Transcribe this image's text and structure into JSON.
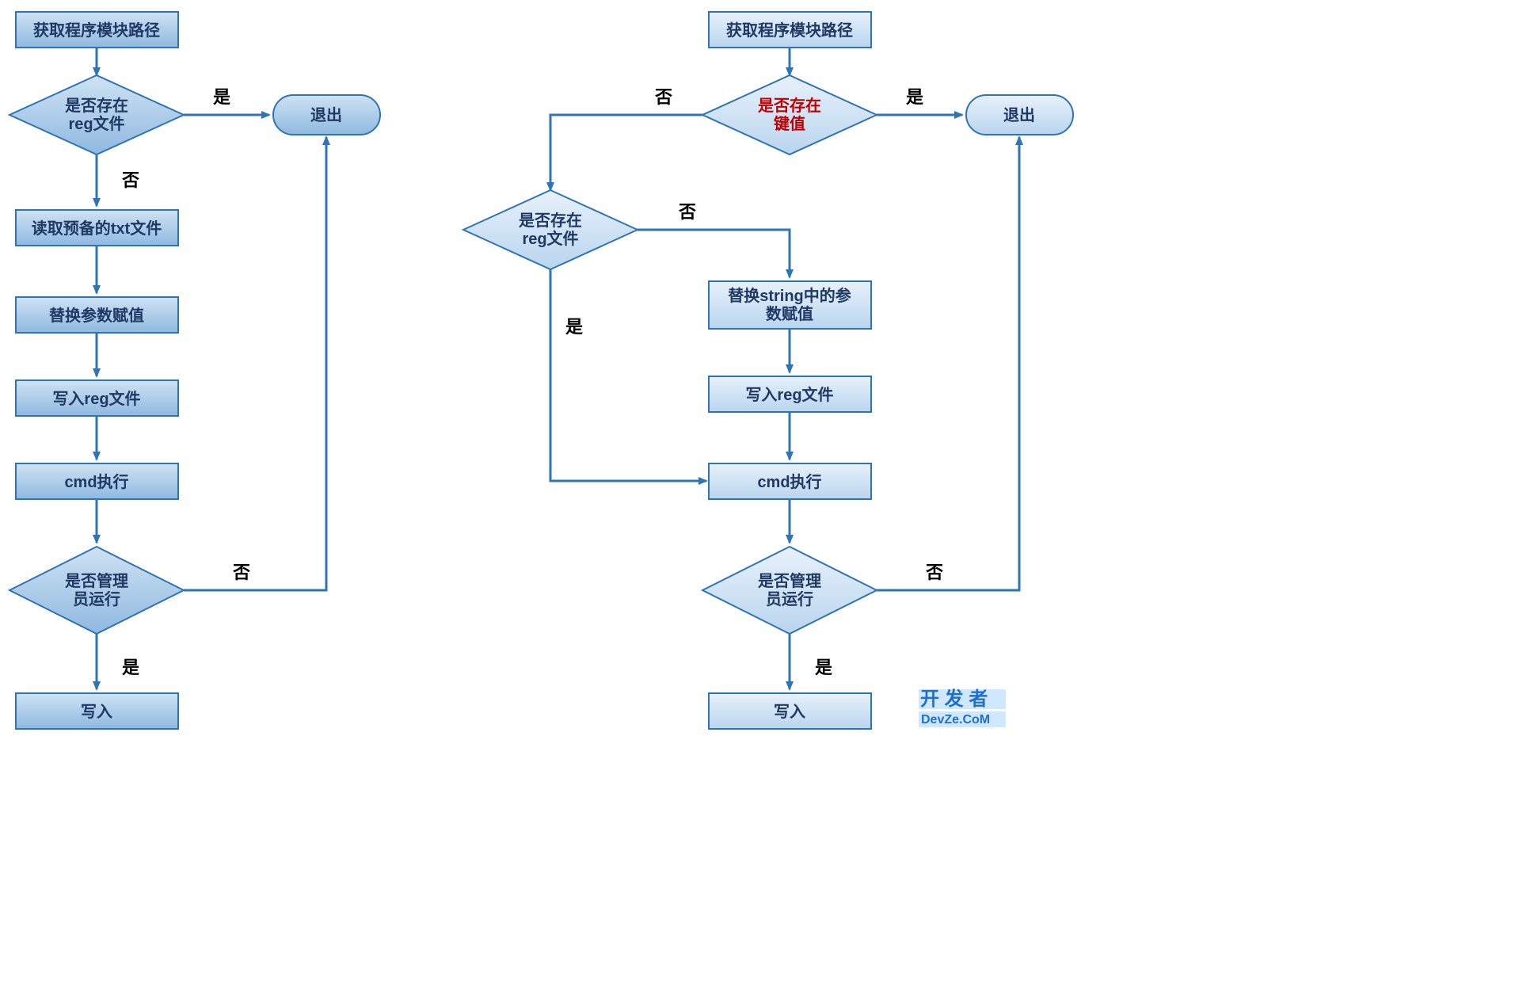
{
  "left": {
    "start": "获取程序模块路径",
    "d1_l1": "是否存在",
    "d1_l2": "reg文件",
    "exit": "退出",
    "step1": "读取预备的txt文件",
    "step2": "替换参数赋值",
    "step3": "写入reg文件",
    "step4": "cmd执行",
    "d2_l1": "是否管理",
    "d2_l2": "员运行",
    "end": "写入",
    "yes": "是",
    "no": "否"
  },
  "right": {
    "start": "获取程序模块路径",
    "d1_l1": "是否存在",
    "d1_l2": "键值",
    "exit": "退出",
    "d2_l1": "是否存在",
    "d2_l2": "reg文件",
    "step1_l1": "替换string中的参",
    "step1_l2": "数赋值",
    "step2": "写入reg文件",
    "step3": "cmd执行",
    "d3_l1": "是否管理",
    "d3_l2": "员运行",
    "end": "写入",
    "yes": "是",
    "no": "否"
  },
  "watermark": {
    "l1": "开 发 者",
    "l2": "DevZe.CoM"
  },
  "colors": {
    "shape_fill_light": "#cfe2f3",
    "shape_fill_dark": "#9cc3e6",
    "stroke": "#2e75b6",
    "arrow": "#2e75b6",
    "highlight_text": "#c00000"
  }
}
